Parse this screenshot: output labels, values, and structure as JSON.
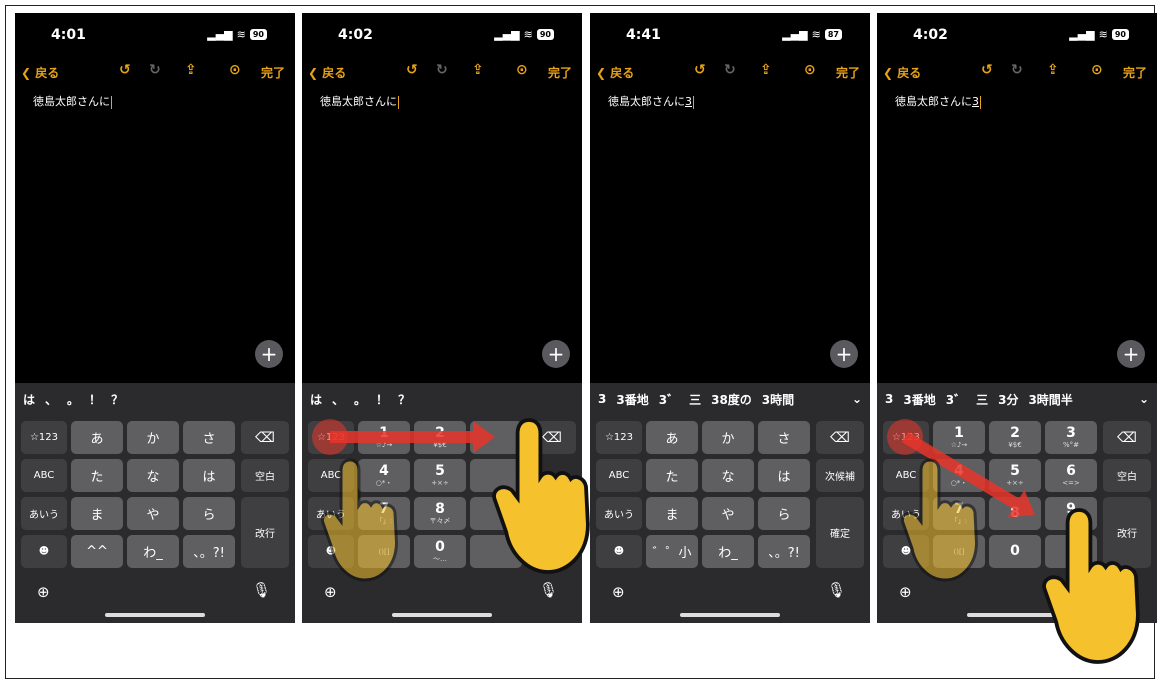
{
  "panels": [
    {
      "time": "4:01",
      "battery": "90",
      "text": "徳島太郎さんに",
      "suffix": "",
      "candidates": [
        "は",
        "、",
        "。",
        "！",
        "？"
      ],
      "candidate_more": "",
      "left_keys": [
        "☆123",
        "ABC",
        "あいう",
        "☻"
      ],
      "keys": [
        [
          "あ",
          "か",
          "さ"
        ],
        [
          "た",
          "な",
          "は"
        ],
        [
          "ま",
          "や",
          "ら"
        ],
        [
          "^^",
          "わ_",
          "、。?!"
        ]
      ],
      "right_keys": [
        "⌫",
        "空白",
        "改行"
      ]
    },
    {
      "time": "4:02",
      "battery": "90",
      "text": "徳島太郎さんに",
      "suffix": "",
      "candidates": [
        "は",
        "、",
        "。",
        "！",
        "？"
      ],
      "candidate_more": "",
      "left_keys": [
        "☆123",
        "ABC",
        "あいう",
        "☻"
      ],
      "numkeys": [
        {
          "n": "1",
          "s": "☆♪→"
        },
        {
          "n": "2",
          "s": "¥$€"
        },
        {
          "n": "",
          "s": ""
        },
        {
          "n": "4",
          "s": "○*・"
        },
        {
          "n": "5",
          "s": "+×÷"
        },
        {
          "n": "",
          "s": ""
        },
        {
          "n": "7",
          "s": "「」:"
        },
        {
          "n": "8",
          "s": "〒々〆"
        },
        {
          "n": "",
          "s": ""
        },
        {
          "n": "",
          "s": "()[]"
        },
        {
          "n": "0",
          "s": "〜…"
        },
        {
          "n": "",
          "s": ""
        }
      ],
      "right_keys": [
        "⌫",
        "",
        ""
      ]
    },
    {
      "time": "4:41",
      "battery": "87",
      "text": "徳島太郎さんに",
      "suffix": "3",
      "candidates": [
        "3",
        "3番地",
        "3゛",
        "三",
        "38度の",
        "3時間"
      ],
      "candidate_more": "⌄",
      "left_keys": [
        "☆123",
        "ABC",
        "あいう",
        "☻"
      ],
      "keys": [
        [
          "あ",
          "か",
          "さ"
        ],
        [
          "た",
          "な",
          "は"
        ],
        [
          "ま",
          "や",
          "ら"
        ],
        [
          "゛゜小",
          "わ_",
          "、。?!"
        ]
      ],
      "right_keys": [
        "⌫",
        "次候補",
        "確定"
      ]
    },
    {
      "time": "4:02",
      "battery": "90",
      "text": "徳島太郎さんに",
      "suffix": "3",
      "candidates": [
        "3",
        "3番地",
        "3゛",
        "三",
        "3分",
        "3時間半"
      ],
      "candidate_more": "⌄",
      "left_keys": [
        "☆123",
        "ABC",
        "あいう",
        "☻"
      ],
      "numkeys": [
        {
          "n": "1",
          "s": "☆♪→"
        },
        {
          "n": "2",
          "s": "¥$€"
        },
        {
          "n": "3",
          "s": "%°#"
        },
        {
          "n": "4",
          "s": "○*・"
        },
        {
          "n": "5",
          "s": "+×÷"
        },
        {
          "n": "6",
          "s": "<=>"
        },
        {
          "n": "7",
          "s": "「」:"
        },
        {
          "n": "8",
          "s": ""
        },
        {
          "n": "9",
          "s": "^|\\"
        },
        {
          "n": "",
          "s": "()[]"
        },
        {
          "n": "0",
          "s": ""
        },
        {
          "n": "",
          "s": ""
        }
      ],
      "right_keys": [
        "⌫",
        "空白",
        "改行"
      ]
    }
  ],
  "toolbar": {
    "back_label": "戻る",
    "done_label": "完了"
  },
  "colors": {
    "accent": "#e8a317",
    "key": "#5f5f62",
    "background": "#000000"
  }
}
